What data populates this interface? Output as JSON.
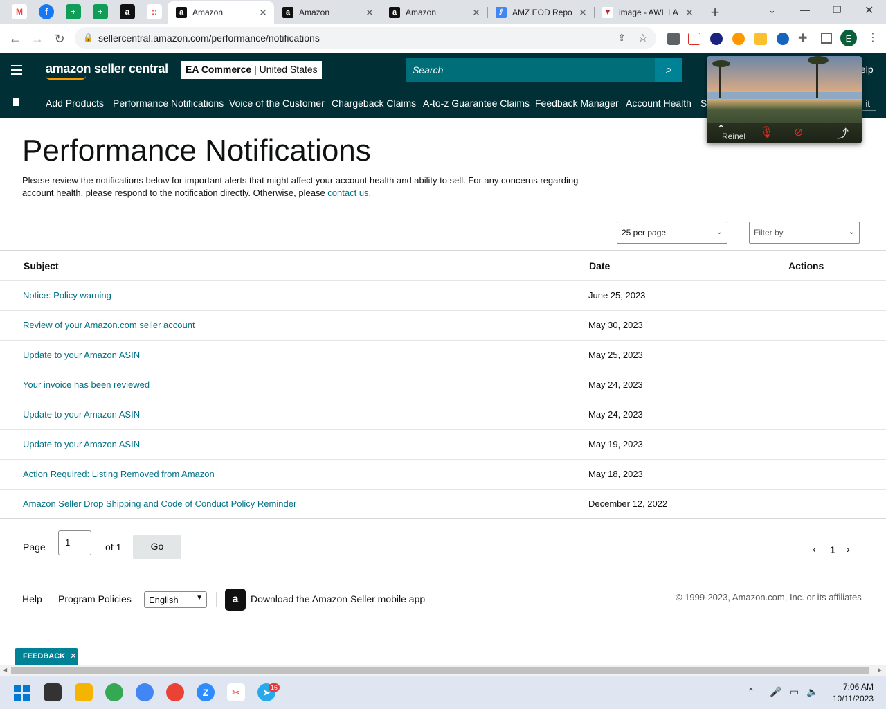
{
  "browser": {
    "pinned_tabs": [
      "M",
      "f",
      "+",
      "+",
      "a",
      "::"
    ],
    "tabs": [
      {
        "title": "Amazon",
        "active": true
      },
      {
        "title": "Amazon",
        "active": false
      },
      {
        "title": "Amazon",
        "active": false
      },
      {
        "title": "AMZ EOD Repo",
        "active": false
      },
      {
        "title": "image - AWL LA",
        "active": false
      }
    ],
    "new_tab": "+",
    "url": "sellercentral.amazon.com/performance/notifications",
    "profile_initial": "E"
  },
  "header": {
    "logo": "amazon seller central",
    "store_bold": "EA Commerce",
    "store_region": "United States",
    "search_placeholder": "Search",
    "help_fragment": "elp"
  },
  "nav": {
    "items": [
      "Add Products",
      "Performance Notifications",
      "Voice of the Customer",
      "Chargeback Claims",
      "A-to-z Guarantee Claims",
      "Feedback Manager",
      "Account Health",
      "S"
    ],
    "edit_fragment": "it"
  },
  "video_call": {
    "participant": "Reinel"
  },
  "page": {
    "title": "Performance Notifications",
    "intro": "Please review the notifications below for important alerts that might affect your account health and ability to sell. For any concerns regarding account health, please respond to the notification directly. Otherwise, please ",
    "contact_link": "contact us.",
    "per_page": "25 per page",
    "filter": "Filter by"
  },
  "table": {
    "headers": {
      "subject": "Subject",
      "date": "Date",
      "actions": "Actions"
    },
    "rows": [
      {
        "subject": "Notice: Policy warning",
        "date": "June 25, 2023"
      },
      {
        "subject": "Review of your Amazon.com seller account",
        "date": "May 30, 2023"
      },
      {
        "subject": "Update to your Amazon ASIN",
        "date": "May 25, 2023"
      },
      {
        "subject": "Your invoice has been reviewed",
        "date": "May 24, 2023"
      },
      {
        "subject": "Update to your Amazon ASIN",
        "date": "May 24, 2023"
      },
      {
        "subject": "Update to your Amazon ASIN",
        "date": "May 19, 2023"
      },
      {
        "subject": "Action Required: Listing Removed from Amazon",
        "date": "May 18, 2023"
      },
      {
        "subject": "Amazon Seller Drop Shipping and Code of Conduct Policy Reminder",
        "date": "December 12, 2022"
      }
    ]
  },
  "pagination": {
    "page_label": "Page",
    "page_value": "1",
    "of_label": "of 1",
    "go": "Go",
    "current": "1"
  },
  "footer": {
    "help": "Help",
    "policies": "Program Policies",
    "language": "English",
    "app": "Download the Amazon Seller mobile app",
    "copyright": "© 1999-2023, Amazon.com, Inc. or its affiliates",
    "feedback": "FEEDBACK"
  },
  "taskbar": {
    "time": "7:06 AM",
    "date": "10/11/2023",
    "badge": "16"
  },
  "colors": {
    "header_bg": "#002f36",
    "link": "#007185",
    "search_btn": "#008296"
  }
}
